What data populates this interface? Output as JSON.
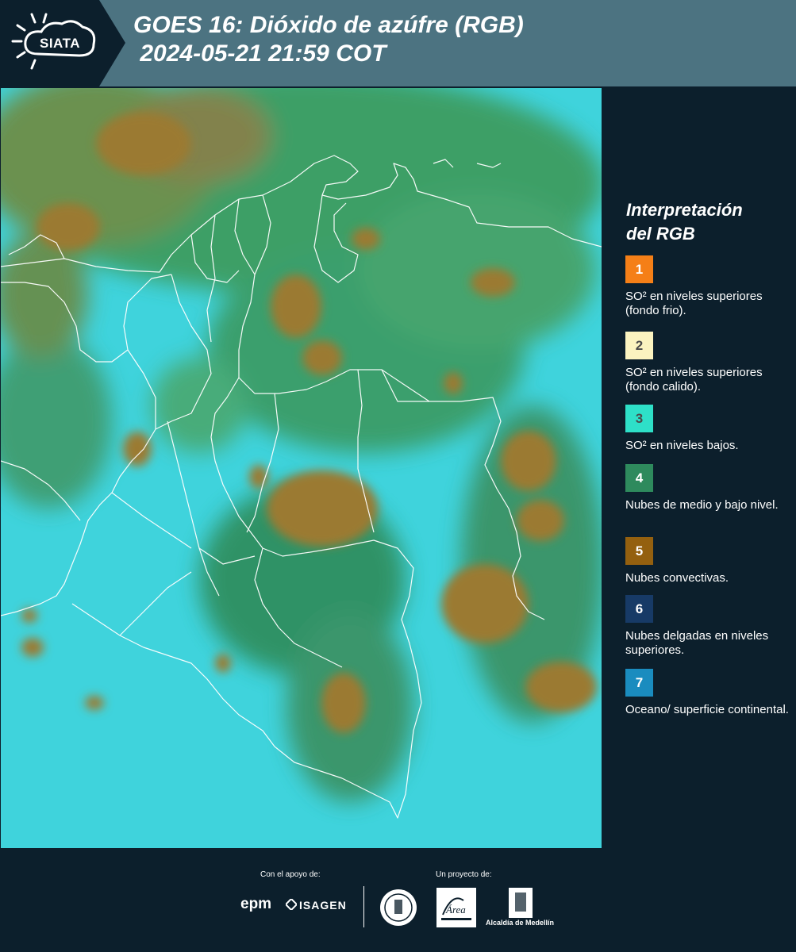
{
  "header": {
    "logo_text": "SIATA",
    "title_line1": "GOES 16: Dióxido de azúfre (RGB)",
    "title_line2": " 2024-05-21 21:59 COT",
    "bg_color": "#4c7381"
  },
  "legend": {
    "title_line1": "Interpretación",
    "title_line2": "del RGB",
    "items": [
      {
        "number": "1",
        "color": "#f57f17",
        "label": "SO² en niveles superiores (fondo frio)."
      },
      {
        "number": "2",
        "color": "#fbf3c0",
        "label": "SO² en niveles superiores (fondo calido)."
      },
      {
        "number": "3",
        "color": "#2ee0c8",
        "label": "SO² en niveles bajos."
      },
      {
        "number": "4",
        "color": "#2e8a5d",
        "label": "Nubes de medio y bajo nivel."
      },
      {
        "number": "5",
        "color": "#94600f",
        "label": "Nubes convectivas."
      },
      {
        "number": "6",
        "color": "#173a66",
        "label": "Nubes delgadas en niveles superiores."
      },
      {
        "number": "7",
        "color": "#1a8cbf",
        "label": "Oceano/ superficie continental."
      }
    ]
  },
  "footer": {
    "support_label": "Con el apoyo de:",
    "project_label": "Un proyecto de:",
    "sponsor1": "epm",
    "sponsor2": "ISAGEN",
    "partner_area": "Área",
    "partner_alcaldia": "Alcaldía de Medellín"
  }
}
